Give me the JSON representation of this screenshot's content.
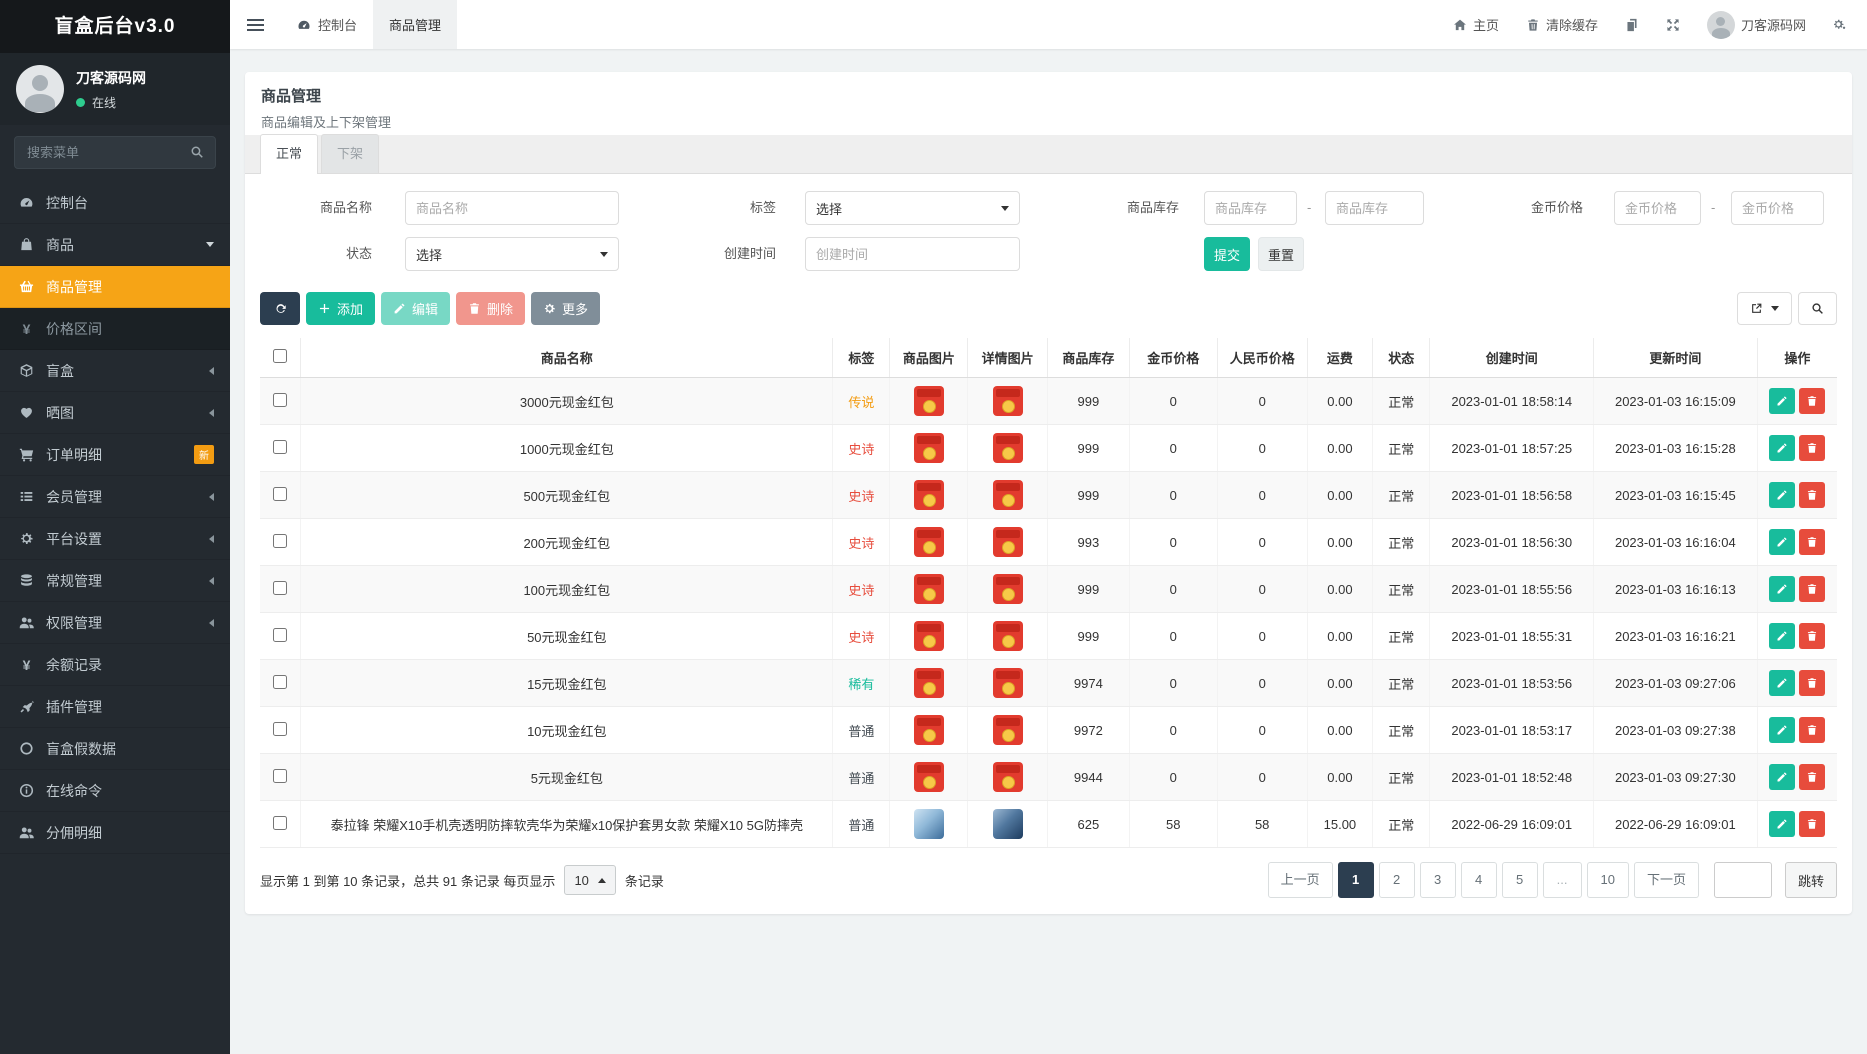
{
  "app": {
    "name": "盲盒后台v3.0"
  },
  "user": {
    "name": "刀客源码网",
    "status": "在线"
  },
  "sidebar": {
    "search_placeholder": "搜索菜单",
    "menu": [
      {
        "label": "控制台",
        "icon": "gauge"
      },
      {
        "label": "商品",
        "icon": "bag",
        "chevron": "down"
      },
      {
        "label": "商品管理",
        "icon": "basket",
        "submenu": true,
        "active": true
      },
      {
        "label": "价格区间",
        "icon": "yen",
        "submenu": true
      },
      {
        "label": "盲盒",
        "icon": "cube",
        "chevron": "left"
      },
      {
        "label": "晒图",
        "icon": "heart",
        "chevron": "left"
      },
      {
        "label": "订单明细",
        "icon": "cart",
        "badge": "新"
      },
      {
        "label": "会员管理",
        "icon": "list",
        "chevron": "left"
      },
      {
        "label": "平台设置",
        "icon": "gear",
        "chevron": "left"
      },
      {
        "label": "常规管理",
        "icon": "database",
        "chevron": "left"
      },
      {
        "label": "权限管理",
        "icon": "users",
        "chevron": "left"
      },
      {
        "label": "余额记录",
        "icon": "yen"
      },
      {
        "label": "插件管理",
        "icon": "rocket"
      },
      {
        "label": "盲盒假数据",
        "icon": "circle"
      },
      {
        "label": "在线命令",
        "icon": "info"
      },
      {
        "label": "分佣明细",
        "icon": "users"
      }
    ]
  },
  "topbar": {
    "tabs": [
      {
        "label": "控制台",
        "icon": "gauge"
      },
      {
        "label": "商品管理",
        "active": true
      }
    ],
    "right": {
      "home": "主页",
      "clear_cache": "清除缓存",
      "username": "刀客源码网"
    }
  },
  "page": {
    "title": "商品管理",
    "subtitle": "商品编辑及上下架管理",
    "tabs": [
      {
        "label": "正常",
        "active": true
      },
      {
        "label": "下架"
      }
    ]
  },
  "filters": {
    "name_label": "商品名称",
    "name_placeholder": "商品名称",
    "tag_label": "标签",
    "tag_value": "选择",
    "stock_label": "商品库存",
    "stock_placeholder": "商品库存",
    "gold_label": "金币价格",
    "gold_placeholder": "金币价格",
    "status_label": "状态",
    "status_value": "选择",
    "created_label": "创建时间",
    "created_placeholder": "创建时间",
    "submit": "提交",
    "reset": "重置"
  },
  "toolbar": {
    "add": "添加",
    "edit": "编辑",
    "delete": "删除",
    "more": "更多"
  },
  "table": {
    "headers": [
      "商品名称",
      "标签",
      "商品图片",
      "详情图片",
      "商品库存",
      "金币价格",
      "人民币价格",
      "运费",
      "状态",
      "创建时间",
      "更新时间",
      "操作"
    ],
    "rows": [
      {
        "name": "3000元现金红包",
        "tag": "传说",
        "tag_type": "legend",
        "image": "redpacket",
        "stock": "999",
        "gold": "0",
        "rmb": "0",
        "freight": "0.00",
        "status": "正常",
        "created": "2023-01-01 18:58:14",
        "updated": "2023-01-03 16:15:09"
      },
      {
        "name": "1000元现金红包",
        "tag": "史诗",
        "tag_type": "epic",
        "image": "redpacket",
        "stock": "999",
        "gold": "0",
        "rmb": "0",
        "freight": "0.00",
        "status": "正常",
        "created": "2023-01-01 18:57:25",
        "updated": "2023-01-03 16:15:28"
      },
      {
        "name": "500元现金红包",
        "tag": "史诗",
        "tag_type": "epic",
        "image": "redpacket",
        "stock": "999",
        "gold": "0",
        "rmb": "0",
        "freight": "0.00",
        "status": "正常",
        "created": "2023-01-01 18:56:58",
        "updated": "2023-01-03 16:15:45"
      },
      {
        "name": "200元现金红包",
        "tag": "史诗",
        "tag_type": "epic",
        "image": "redpacket",
        "stock": "993",
        "gold": "0",
        "rmb": "0",
        "freight": "0.00",
        "status": "正常",
        "created": "2023-01-01 18:56:30",
        "updated": "2023-01-03 16:16:04"
      },
      {
        "name": "100元现金红包",
        "tag": "史诗",
        "tag_type": "epic",
        "image": "redpacket",
        "stock": "999",
        "gold": "0",
        "rmb": "0",
        "freight": "0.00",
        "status": "正常",
        "created": "2023-01-01 18:55:56",
        "updated": "2023-01-03 16:16:13"
      },
      {
        "name": "50元现金红包",
        "tag": "史诗",
        "tag_type": "epic",
        "image": "redpacket",
        "stock": "999",
        "gold": "0",
        "rmb": "0",
        "freight": "0.00",
        "status": "正常",
        "created": "2023-01-01 18:55:31",
        "updated": "2023-01-03 16:16:21"
      },
      {
        "name": "15元现金红包",
        "tag": "稀有",
        "tag_type": "rare",
        "image": "redpacket",
        "stock": "9974",
        "gold": "0",
        "rmb": "0",
        "freight": "0.00",
        "status": "正常",
        "created": "2023-01-01 18:53:56",
        "updated": "2023-01-03 09:27:06"
      },
      {
        "name": "10元现金红包",
        "tag": "普通",
        "tag_type": "common",
        "image": "redpacket",
        "stock": "9972",
        "gold": "0",
        "rmb": "0",
        "freight": "0.00",
        "status": "正常",
        "created": "2023-01-01 18:53:17",
        "updated": "2023-01-03 09:27:38"
      },
      {
        "name": "5元现金红包",
        "tag": "普通",
        "tag_type": "common",
        "image": "redpacket",
        "stock": "9944",
        "gold": "0",
        "rmb": "0",
        "freight": "0.00",
        "status": "正常",
        "created": "2023-01-01 18:52:48",
        "updated": "2023-01-03 09:27:30"
      },
      {
        "name": "泰拉锋 荣耀X10手机壳透明防摔软壳华为荣耀x10保护套男女款 荣耀X10 5G防摔壳",
        "tag": "普通",
        "tag_type": "common",
        "image": "phonecase",
        "stock": "625",
        "gold": "58",
        "rmb": "58",
        "freight": "15.00",
        "status": "正常",
        "created": "2022-06-29 16:09:01",
        "updated": "2022-06-29 16:09:01"
      }
    ]
  },
  "pagination": {
    "summary_prefix": "显示第 1 到第 10 条记录，总共 91 条记录 每页显示",
    "page_size": "10",
    "summary_suffix": "条记录",
    "prev": "上一页",
    "next": "下一页",
    "pages": [
      "1",
      "2",
      "3",
      "4",
      "5",
      "...",
      "10"
    ],
    "active": "1",
    "jump": "跳转"
  },
  "colors": {
    "accent_teal": "#18bc9c",
    "primary_navy": "#2c3e50",
    "active_orange": "#f6a416",
    "danger_red": "#e74c3c",
    "tag_legend": "#f39c12",
    "tag_epic": "#e74c3c",
    "tag_rare": "#18bc9c",
    "tag_common": "#454d54"
  }
}
